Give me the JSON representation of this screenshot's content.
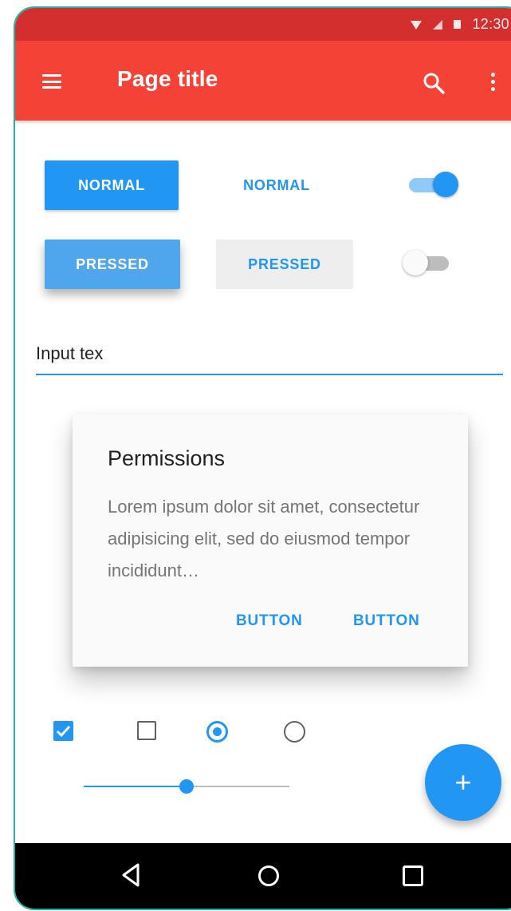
{
  "status_bar": {
    "time": "12:30",
    "icons": [
      "wifi-icon",
      "signal-icon",
      "battery-icon"
    ]
  },
  "toolbar": {
    "title": "Page title",
    "menu_icon": "hamburger-menu-icon",
    "search_icon": "search-icon",
    "overflow_icon": "more-vertical-icon"
  },
  "buttons": {
    "raised_normal": "NORMAL",
    "flat_normal": "NORMAL",
    "raised_pressed": "PRESSED",
    "flat_pressed": "PRESSED"
  },
  "switches": {
    "top_on": true,
    "bottom_on": false
  },
  "input": {
    "value": "Input tex"
  },
  "dialog": {
    "title": "Permissions",
    "body": "Lorem ipsum dolor sit amet, consectetur adipisicing elit, sed do eiusmod tempor incididunt…",
    "button_1": "BUTTON",
    "button_2": "BUTTON"
  },
  "controls": {
    "checkbox_1_checked": true,
    "checkbox_2_checked": false,
    "radio_1_selected": true,
    "radio_2_selected": false,
    "slider_value": 0.5
  },
  "fab": {
    "label": "+",
    "icon": "add-icon"
  },
  "nav_bar": {
    "icons": [
      "back-icon",
      "home-icon",
      "recents-icon"
    ]
  },
  "colors": {
    "status_bar": "#d32f2f",
    "toolbar": "#f44336",
    "accent": "#2196f3",
    "nav_bar": "#000000",
    "frame_border": "#1fb5a6"
  }
}
